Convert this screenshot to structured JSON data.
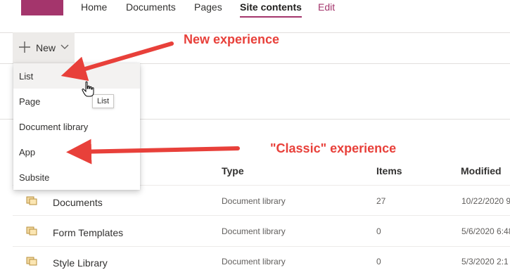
{
  "nav": {
    "items": [
      "Home",
      "Documents",
      "Pages",
      "Site contents",
      "Edit"
    ],
    "active": "Site contents"
  },
  "command_bar": {
    "new_label": "New"
  },
  "new_menu": {
    "items": [
      "List",
      "Page",
      "Document library",
      "App",
      "Subsite"
    ],
    "hovered": "List",
    "tooltip": "List"
  },
  "table": {
    "headers": {
      "type": "Type",
      "items": "Items",
      "modified": "Modified"
    },
    "rows": [
      {
        "name": "Documents",
        "type": "Document library",
        "items": "27",
        "modified": "10/22/2020 9"
      },
      {
        "name": "Form Templates",
        "type": "Document library",
        "items": "0",
        "modified": "5/6/2020 6:48"
      },
      {
        "name": "Style Library",
        "type": "Document library",
        "items": "0",
        "modified": "5/3/2020 2:1"
      }
    ]
  },
  "annotations": {
    "new_experience": "New experience",
    "classic_experience": "\"Classic\" experience"
  },
  "colors": {
    "brand": "#a4356c",
    "annotation": "#e8403a"
  }
}
